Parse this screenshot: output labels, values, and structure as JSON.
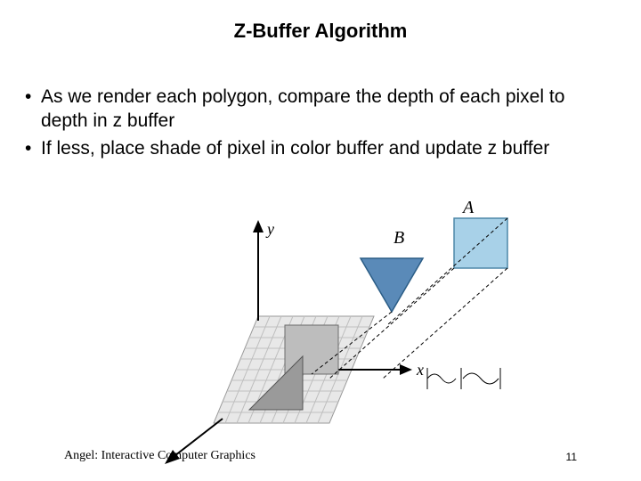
{
  "title": "Z-Buffer Algorithm",
  "bullets": {
    "b1": "As we render each polygon, compare the depth of each pixel to depth in z buffer",
    "b2": "If less, place shade of pixel in color buffer and update z buffer"
  },
  "figure": {
    "labels": {
      "A": "A",
      "B": "B",
      "x": "x",
      "y": "y"
    }
  },
  "footer": {
    "left": "Angel: Interactive Computer Graphics",
    "right": "11"
  }
}
